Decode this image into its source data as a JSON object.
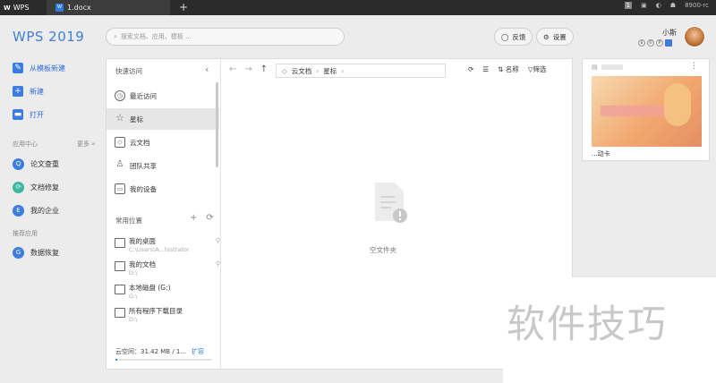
{
  "titlebar": {
    "home_tab": "WPS",
    "doc_tab": "1.docx",
    "add_tab": "+",
    "account": "8900-rc",
    "page_badge": "1"
  },
  "header": {
    "logo": "WPS 2019",
    "search_placeholder": "搜索文档、应用、模板 ...",
    "feedback_label": "反馈",
    "settings_label": "设置",
    "user_name": "小斯"
  },
  "left_nav": {
    "new_from_template": "从模板新建",
    "new": "新建",
    "open": "打开",
    "app_center": "应用中心",
    "more": "更多 »",
    "paper_check": "论文查重",
    "doc_repair": "文档修复",
    "my_enterprise": "我的企业",
    "recommended": "推荐应用",
    "data_recovery": "数据恢复"
  },
  "quick_access": {
    "title": "快速访问",
    "items": [
      {
        "label": "最近访问",
        "icon": "clock-icon"
      },
      {
        "label": "星标",
        "icon": "star-icon"
      },
      {
        "label": "云文档",
        "icon": "cube-icon"
      },
      {
        "label": "团队共享",
        "icon": "team-icon"
      },
      {
        "label": "我的设备",
        "icon": "device-icon"
      }
    ]
  },
  "common_locations": {
    "title": "常用位置",
    "items": [
      {
        "name": "我的桌面",
        "path": "C:\\Users\\A...histrator"
      },
      {
        "name": "我的文档",
        "path": "D:\\"
      },
      {
        "name": "本地磁盘 (G:)",
        "path": "G:\\"
      },
      {
        "name": "所有程序下载目录",
        "path": "D:\\"
      }
    ]
  },
  "cloud": {
    "usage": "云空间：31.42 MB / 1...",
    "expand": "扩容",
    "fill_fraction": 0.02
  },
  "file_area": {
    "crumb_root": "云文档",
    "crumb_current": "星标",
    "sort_label": "名称",
    "filter_label": "筛选",
    "empty_text": "空文件夹"
  },
  "recent_card": {
    "caption": "...动卡"
  },
  "watermark": "软件技巧",
  "colors": {
    "accent": "#3b7de1",
    "titlebar": "#2b2b2b"
  }
}
